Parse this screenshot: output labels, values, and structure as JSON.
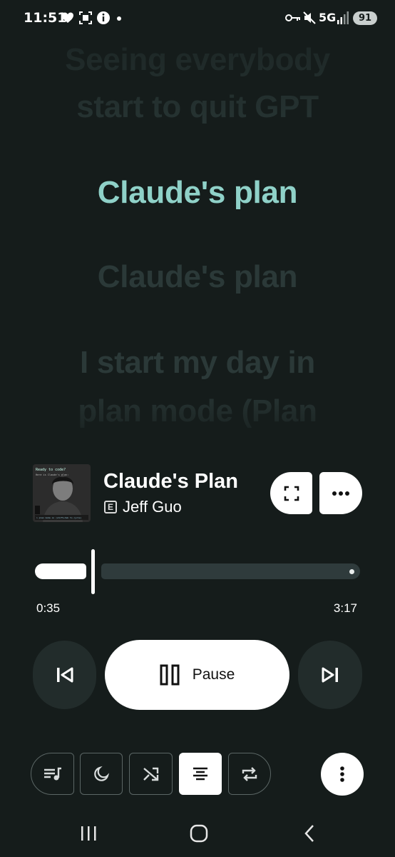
{
  "status_bar": {
    "time": "11:51",
    "network": "5G",
    "battery": "91",
    "icons": [
      "heart-icon",
      "screenshot-icon",
      "info-icon",
      "dot-icon",
      "vpn-key-icon",
      "mute-icon",
      "signal-icon",
      "battery-icon"
    ]
  },
  "lyrics": {
    "lines": [
      "Seeing everybody",
      "start to quit GPT",
      "Claude's plan",
      "Claude's plan",
      "I start my day in",
      "plan mode (Plan"
    ],
    "active_index": 2,
    "active_color": "#8fd1c8"
  },
  "now_playing": {
    "title": "Claude's Plan",
    "artist": "Jeff Guo",
    "explicit_badge": "E",
    "album_art": {
      "caption_top": "Ready to code?",
      "caption_sub": "Here is Claude's plan:",
      "caption_bottom": "> plan mode on (shift+tab to cycle)"
    }
  },
  "playback": {
    "elapsed": "0:35",
    "total": "3:17",
    "progress_fraction": 0.18,
    "pause_label": "Pause"
  },
  "toolbar": {
    "items": [
      "queue-icon",
      "sleep-timer-icon",
      "shuffle-icon",
      "lyrics-icon",
      "repeat-icon"
    ],
    "active": "lyrics-icon"
  },
  "colors": {
    "background": "#151c1b",
    "accent": "#8fd1c8",
    "button_fill": "#ffffff",
    "surface": "#222c2b"
  }
}
